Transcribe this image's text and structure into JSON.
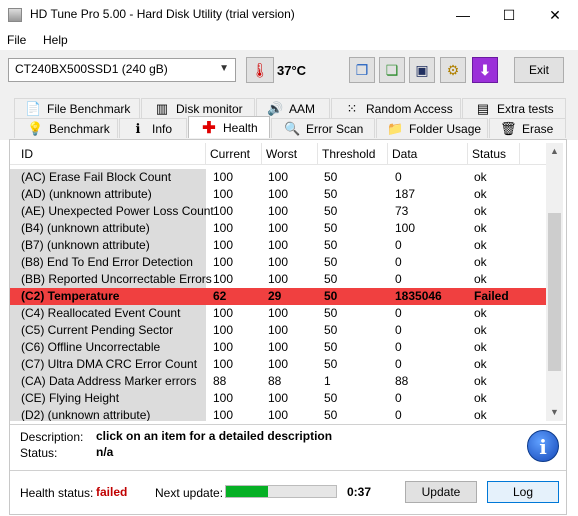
{
  "window": {
    "title": "HD Tune Pro 5.00 - Hard Disk Utility (trial version)",
    "min_glyph": "—",
    "max_glyph": "☐",
    "close_glyph": "✕"
  },
  "menu": {
    "file": "File",
    "help": "Help"
  },
  "toolbar": {
    "drive": "CT240BX500SSD1 (240 gB)",
    "temperature": "37°C",
    "exit_label": "Exit",
    "icons": [
      "thermometer-icon",
      "copy-icon",
      "copy-info-icon",
      "save-icon",
      "options-icon",
      "download-icon"
    ]
  },
  "tabs": {
    "row1": [
      "File Benchmark",
      "Disk monitor",
      "AAM",
      "Random Access",
      "Extra tests"
    ],
    "row2": [
      "Benchmark",
      "Info",
      "Health",
      "Error Scan",
      "Folder Usage",
      "Erase"
    ],
    "active": "Health"
  },
  "table": {
    "headers": [
      "ID",
      "Current",
      "Worst",
      "Threshold",
      "Data",
      "Status"
    ],
    "rows": [
      [
        "(AC) Erase Fail Block Count",
        "100",
        "100",
        "50",
        "0",
        "ok"
      ],
      [
        "(AD) (unknown attribute)",
        "100",
        "100",
        "50",
        "187",
        "ok"
      ],
      [
        "(AE) Unexpected Power Loss Count",
        "100",
        "100",
        "50",
        "73",
        "ok"
      ],
      [
        "(B4) (unknown attribute)",
        "100",
        "100",
        "50",
        "100",
        "ok"
      ],
      [
        "(B7) (unknown attribute)",
        "100",
        "100",
        "50",
        "0",
        "ok"
      ],
      [
        "(B8) End To End Error Detection",
        "100",
        "100",
        "50",
        "0",
        "ok"
      ],
      [
        "(BB) Reported Uncorrectable Errors",
        "100",
        "100",
        "50",
        "0",
        "ok"
      ],
      [
        "(C2) Temperature",
        "62",
        "29",
        "50",
        "1835046",
        "Failed"
      ],
      [
        "(C4) Reallocated Event Count",
        "100",
        "100",
        "50",
        "0",
        "ok"
      ],
      [
        "(C5) Current Pending Sector",
        "100",
        "100",
        "50",
        "0",
        "ok"
      ],
      [
        "(C6) Offline Uncorrectable",
        "100",
        "100",
        "50",
        "0",
        "ok"
      ],
      [
        "(C7) Ultra DMA CRC Error Count",
        "100",
        "100",
        "50",
        "0",
        "ok"
      ],
      [
        "(CA) Data Address Marker errors",
        "88",
        "88",
        "1",
        "88",
        "ok"
      ],
      [
        "(CE) Flying Height",
        "100",
        "100",
        "50",
        "0",
        "ok"
      ],
      [
        "(D2) (unknown attribute)",
        "100",
        "100",
        "50",
        "0",
        "ok"
      ]
    ],
    "failed_row_index": 7,
    "failed_color": "#f04040"
  },
  "description": {
    "desc_label": "Description:",
    "desc_value": "click on an item for a detailed description",
    "status_label": "Status:",
    "status_value": "n/a",
    "info_glyph": "i"
  },
  "bottom": {
    "health_label": "Health status:",
    "health_value": "failed",
    "health_color": "#c00000",
    "next_update_label": "Next update:",
    "progress_fraction": 0.38,
    "countdown": "0:37",
    "update_label": "Update",
    "log_label": "Log"
  }
}
